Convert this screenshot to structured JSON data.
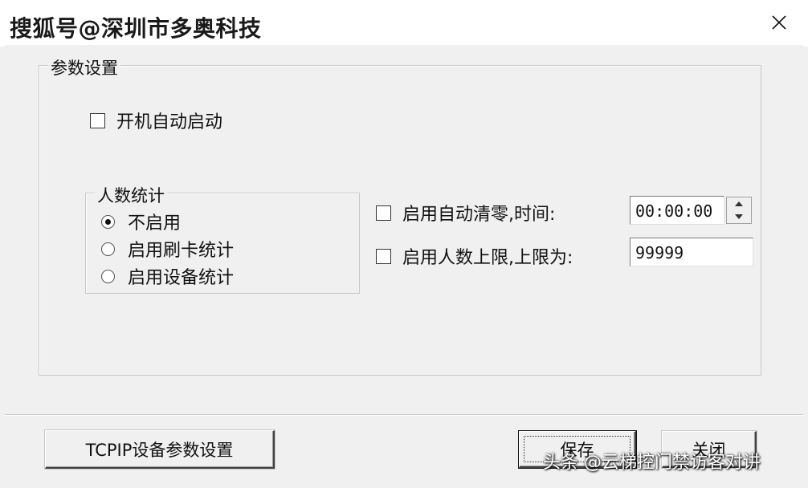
{
  "window": {
    "title": "搜狐号@深圳市多奥科技",
    "close_icon": "close-icon"
  },
  "params_group": {
    "label": "参数设置",
    "auto_start": {
      "label": "开机自动启动",
      "checked": false
    }
  },
  "count_group": {
    "label": "人数统计",
    "options": [
      {
        "label": "不启用",
        "selected": true
      },
      {
        "label": "启用刷卡统计",
        "selected": false
      },
      {
        "label": "启用设备统计",
        "selected": false
      }
    ]
  },
  "auto_clear": {
    "label": "启用自动清零,时间:",
    "checked": false,
    "time_value": "00:00:00"
  },
  "limit": {
    "label": "启用人数上限,上限为:",
    "checked": false,
    "value": "99999"
  },
  "buttons": {
    "tcpip": "TCPIP设备参数设置",
    "save": "保存",
    "close": "关闭"
  },
  "watermark": "头条 @云梯控门禁访客对讲"
}
